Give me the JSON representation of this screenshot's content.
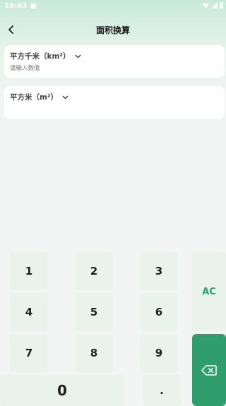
{
  "status_bar": {
    "time": "10:42"
  },
  "header": {
    "title": "面积换算"
  },
  "source": {
    "unit_label": "平方千米（km²）",
    "input_placeholder": "请输入数值"
  },
  "target": {
    "unit_label": "平方米（m²）"
  },
  "keypad": {
    "keys": [
      "1",
      "2",
      "3",
      "4",
      "5",
      "6",
      "7",
      "8",
      "9",
      "0",
      "."
    ],
    "ac_label": "AC"
  },
  "colors": {
    "accent": "#2f9e6c",
    "key_bg": "#e9f3ec"
  },
  "icons": [
    "back-arrow-icon",
    "chevron-down-icon",
    "backspace-icon"
  ]
}
